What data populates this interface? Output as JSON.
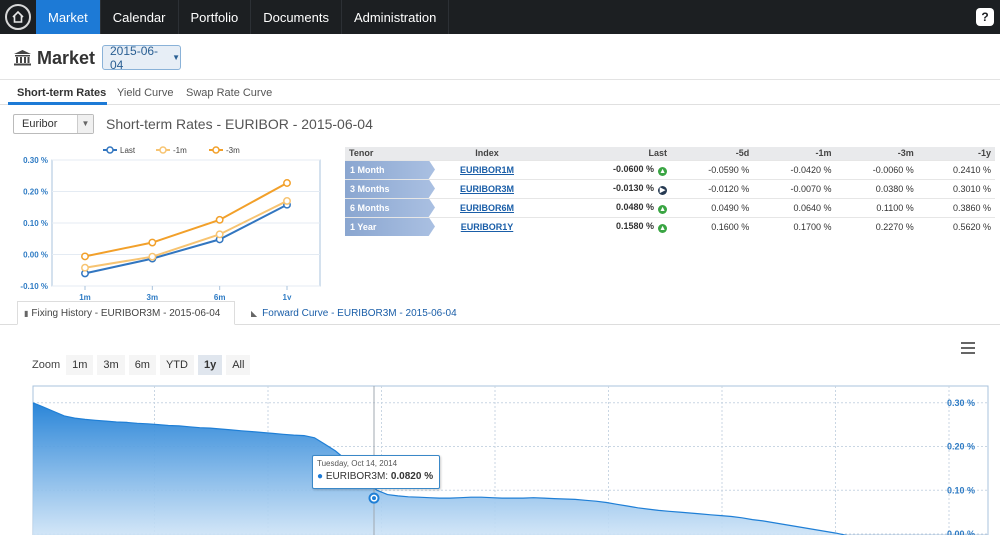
{
  "nav": {
    "items": [
      "Market",
      "Calendar",
      "Portfolio",
      "Documents",
      "Administration"
    ],
    "help": "?"
  },
  "header": {
    "title": "Market",
    "date": "2015-06-04"
  },
  "tabs": [
    "Short-term Rates",
    "Yield Curve",
    "Swap Rate Curve"
  ],
  "selector": {
    "value": "Euribor"
  },
  "section_title": "Short-term Rates - EURIBOR - 2015-06-04",
  "table": {
    "headers": [
      "Tenor",
      "Index",
      "Last",
      "-5d",
      "-1m",
      "-3m",
      "-1y"
    ],
    "rows": [
      {
        "tenor": "1 Month",
        "index": "EURIBOR1M",
        "last": "-0.0600 %",
        "d5": "-0.0590 %",
        "m1": "-0.0420 %",
        "m3": "-0.0060 %",
        "y1": "0.2410 %",
        "trend": "up"
      },
      {
        "tenor": "3 Months",
        "index": "EURIBOR3M",
        "last": "-0.0130 %",
        "d5": "-0.0120 %",
        "m1": "-0.0070 %",
        "m3": "0.0380 %",
        "y1": "0.3010 %",
        "trend": "right"
      },
      {
        "tenor": "6 Months",
        "index": "EURIBOR6M",
        "last": "0.0480 %",
        "d5": "0.0490 %",
        "m1": "0.0640 %",
        "m3": "0.1100 %",
        "y1": "0.3860 %",
        "trend": "up"
      },
      {
        "tenor": "1 Year",
        "index": "EURIBOR1Y",
        "last": "0.1580 %",
        "d5": "0.1600 %",
        "m1": "0.1700 %",
        "m3": "0.2270 %",
        "y1": "0.5620 %",
        "trend": "up"
      }
    ]
  },
  "subtabs": {
    "fixing": "Fixing History - EURIBOR3M - 2015-06-04",
    "forward": "Forward Curve - EURIBOR3M - 2015-06-04"
  },
  "zoom": {
    "label": "Zoom",
    "options": [
      "1m",
      "3m",
      "6m",
      "YTD",
      "1y",
      "All"
    ],
    "selected": "1y"
  },
  "tooltip": {
    "date": "Tuesday, Oct 14, 2014",
    "series": "EURIBOR3M:",
    "value": "0.0820 %"
  },
  "colors": {
    "accent": "#1d7ad6",
    "last": "#3276c0",
    "m1": "#f7c472",
    "m3": "#f2a02a",
    "area": "#2e8bdb"
  },
  "chart_data": [
    {
      "type": "line",
      "categories": [
        "1m",
        "3m",
        "6m",
        "1y"
      ],
      "ylim": [
        -0.1,
        0.3
      ],
      "yticks": [
        "0.30 %",
        "0.20 %",
        "0.10 %",
        "0.00 %",
        "-0.10 %"
      ],
      "legend": "top",
      "series": [
        {
          "name": "Last",
          "values": [
            -0.06,
            -0.013,
            0.048,
            0.158
          ]
        },
        {
          "name": "-1m",
          "values": [
            -0.042,
            -0.007,
            0.064,
            0.17
          ]
        },
        {
          "name": "-3m",
          "values": [
            -0.006,
            0.038,
            0.11,
            0.227
          ]
        }
      ]
    },
    {
      "type": "area",
      "series_name": "EURIBOR3M",
      "ylim": [
        0,
        0.32
      ],
      "yticks": [
        "0.30 %",
        "0.20 %",
        "0.10 %",
        "0.00 %"
      ],
      "values": [
        0.3,
        0.29,
        0.28,
        0.27,
        0.265,
        0.262,
        0.26,
        0.258,
        0.256,
        0.255,
        0.253,
        0.252,
        0.25,
        0.248,
        0.247,
        0.245,
        0.243,
        0.242,
        0.24,
        0.238,
        0.236,
        0.234,
        0.232,
        0.23,
        0.228,
        0.226,
        0.225,
        0.22,
        0.205,
        0.19,
        0.17,
        0.15,
        0.12,
        0.1,
        0.09,
        0.087,
        0.085,
        0.084,
        0.083,
        0.082,
        0.082,
        0.083,
        0.084,
        0.084,
        0.083,
        0.082,
        0.082,
        0.082,
        0.083,
        0.082,
        0.081,
        0.08,
        0.079,
        0.077,
        0.075,
        0.072,
        0.068,
        0.064,
        0.06,
        0.057,
        0.054,
        0.052,
        0.05,
        0.048,
        0.046,
        0.044,
        0.042,
        0.04,
        0.037,
        0.033,
        0.03,
        0.026,
        0.022,
        0.018,
        0.014,
        0.01,
        0.006,
        0.002,
        -0.003,
        -0.008,
        -0.012,
        -0.015,
        -0.017
      ],
      "highlight_value": 0.082
    }
  ]
}
